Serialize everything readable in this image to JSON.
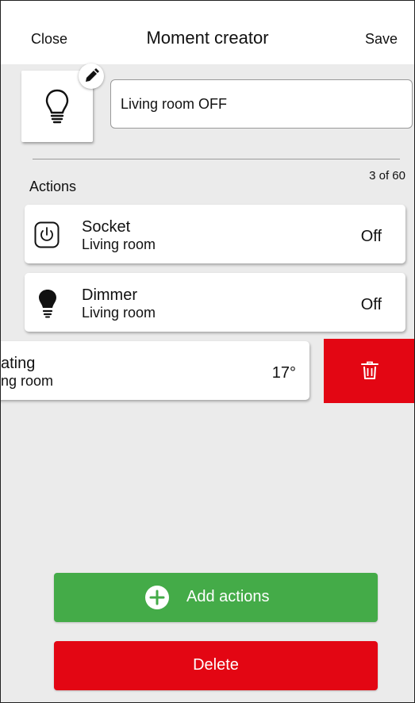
{
  "header": {
    "close_label": "Close",
    "title": "Moment creator",
    "save_label": "Save"
  },
  "moment": {
    "icon": "lightbulb-icon",
    "edit_icon": "pencil-icon",
    "name_value": "Living room OFF"
  },
  "actions": {
    "title": "Actions",
    "count": "3 of 60",
    "items": [
      {
        "name": "Socket",
        "room": "Living room",
        "value": "Off",
        "icon": "power-socket-icon"
      },
      {
        "name": "Dimmer",
        "room": "Living room",
        "value": "Off",
        "icon": "lightbulb-filled-icon"
      },
      {
        "name": "ating",
        "room": "ng room",
        "value": "17°",
        "icon": "",
        "swiped": true
      }
    ],
    "swipe_delete_icon": "trash-icon"
  },
  "buttons": {
    "add_label": "Add actions",
    "add_icon": "plus-circle-icon",
    "delete_label": "Delete"
  },
  "colors": {
    "accent_green": "#44ab48",
    "danger_red": "#e30613",
    "background": "#ebebeb"
  }
}
